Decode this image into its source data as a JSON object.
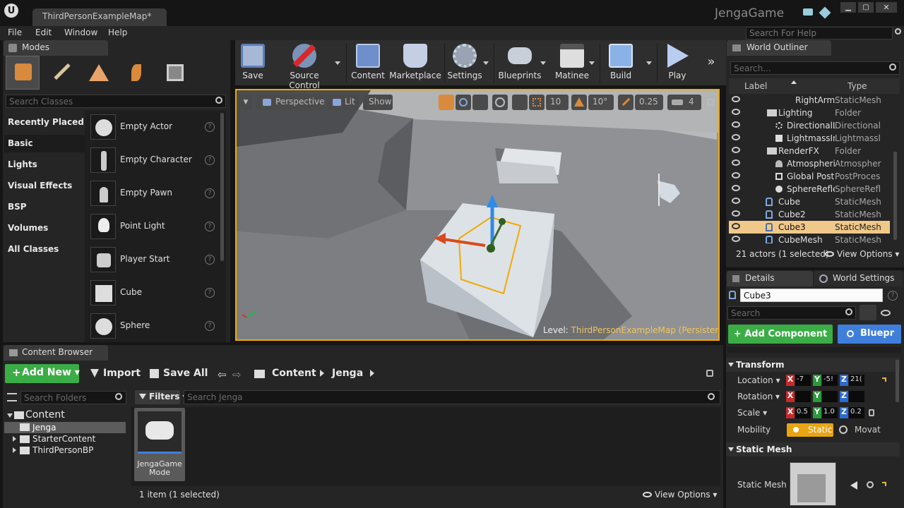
{
  "window": {
    "doc_tab": "ThirdPersonExampleMap*",
    "app_title": "JengaGame",
    "search_help_placeholder": "Search For Help"
  },
  "menu": [
    "File",
    "Edit",
    "Window",
    "Help"
  ],
  "modes": {
    "tab": "Modes",
    "search_placeholder": "Search Classes",
    "categories": [
      "Recently Placed",
      "Basic",
      "Lights",
      "Visual Effects",
      "BSP",
      "Volumes",
      "All Classes"
    ],
    "actors": [
      "Empty Actor",
      "Empty Character",
      "Empty Pawn",
      "Point Light",
      "Player Start",
      "Cube",
      "Sphere"
    ]
  },
  "toolbar": {
    "buttons": [
      "Save",
      "Source Control",
      "Content",
      "Marketplace",
      "Settings",
      "Blueprints",
      "Matinee",
      "Build",
      "Play"
    ]
  },
  "viewport": {
    "perspective": "Perspective",
    "lit": "Lit",
    "show": "Show",
    "grid_snap": "10",
    "rot_snap": "10°",
    "scale_snap": "0.25",
    "cam_speed": "4",
    "level_label": "Level:",
    "level_name": "ThirdPersonExampleMap (Persistent)"
  },
  "outliner": {
    "tab": "World Outliner",
    "search_placeholder": "Search...",
    "col_label": "Label",
    "col_type": "Type",
    "rows": [
      {
        "label": "RightArm_Sta",
        "type": "StaticMesh"
      },
      {
        "label": "Lighting",
        "type": "Folder"
      },
      {
        "label": "DirectionalLigh",
        "type": "Directional"
      },
      {
        "label": "LightmassImpo",
        "type": "Lightmassl"
      },
      {
        "label": "RenderFX",
        "type": "Folder"
      },
      {
        "label": "AtmosphericFo",
        "type": "Atmospher"
      },
      {
        "label": "Global PostPro",
        "type": "PostProces"
      },
      {
        "label": "SphereReflectio",
        "type": "SphereRefl"
      },
      {
        "label": "Cube",
        "type": "StaticMesh"
      },
      {
        "label": "Cube2",
        "type": "StaticMesh"
      },
      {
        "label": "Cube3",
        "type": "StaticMesh"
      },
      {
        "label": "CubeMesh",
        "type": "StaticMesh"
      }
    ],
    "status": "21 actors (1 selected)",
    "view_options": "View Options"
  },
  "details": {
    "tab": "Details",
    "tab2": "World Settings",
    "name": "Cube3",
    "search_placeholder": "Search",
    "add_component": "+ Add Component",
    "blueprint": "Bluepr",
    "transform_header": "Transform",
    "location_label": "Location",
    "rotation_label": "Rotation",
    "scale_label": "Scale",
    "mobility_label": "Mobility",
    "loc": [
      "-7",
      "-5!",
      "21("
    ],
    "scale": [
      "0.5",
      "1.0",
      "0.2"
    ],
    "static": "Static",
    "movable": "Movat",
    "static_mesh_header": "Static Mesh",
    "static_mesh_label": "Static Mesh"
  },
  "content_browser": {
    "tab": "Content Browser",
    "add_new": "Add New",
    "import": "Import",
    "save_all": "Save All",
    "path": [
      "Content",
      "Jenga"
    ],
    "search_folders_placeholder": "Search Folders",
    "filters": "Filters",
    "search_placeholder": "Search Jenga",
    "tree": [
      "Content",
      "Jenga",
      "StarterContent",
      "ThirdPersonBP"
    ],
    "asset_name_1": "JengaGame",
    "asset_name_2": "Mode",
    "status": "1 item (1 selected)",
    "view_options": "View Options"
  }
}
